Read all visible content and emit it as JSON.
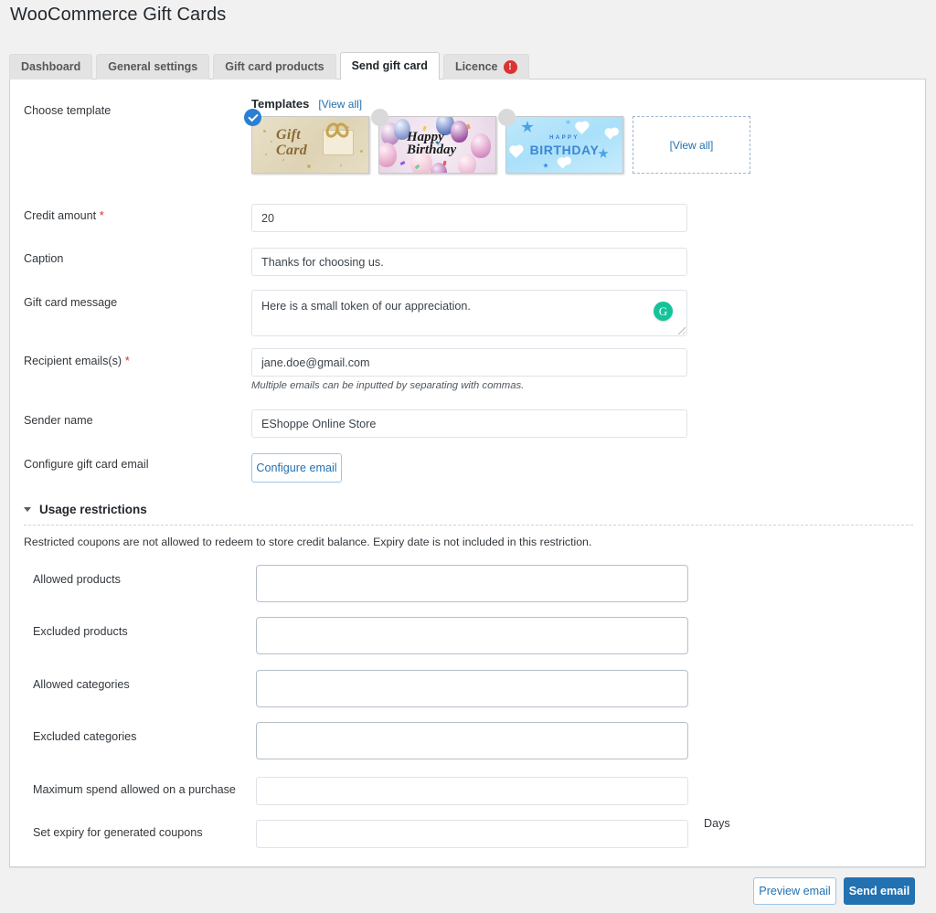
{
  "header": {
    "title": "WooCommerce Gift Cards"
  },
  "tabs": [
    {
      "label": "Dashboard",
      "active": false
    },
    {
      "label": "General settings",
      "active": false
    },
    {
      "label": "Gift card products",
      "active": false
    },
    {
      "label": "Send gift card",
      "active": true
    },
    {
      "label": "Licence",
      "active": false,
      "badge": "!"
    }
  ],
  "templates": {
    "row_label": "Choose template",
    "heading": "Templates",
    "view_all_link": "[View all]",
    "view_all_box": "[View all]",
    "items": [
      {
        "name": "gift-card-beige",
        "title_line1": "Gift",
        "title_line2": "Card",
        "selected": true
      },
      {
        "name": "happy-birthday-balloons",
        "title": "Happy Birthday",
        "selected": false
      },
      {
        "name": "happy-birthday-blue",
        "title_small": "HAPPY",
        "title_large": "BIRTHDAY",
        "selected": false
      },
      {
        "name": "view-all-placeholder",
        "selected": false
      }
    ]
  },
  "form": {
    "credit_amount": {
      "label": "Credit amount",
      "required": true,
      "value": "20"
    },
    "caption": {
      "label": "Caption",
      "required": false,
      "value": "Thanks for choosing us."
    },
    "gift_card_message": {
      "label": "Gift card message",
      "required": false,
      "value": "Here is a small token of our appreciation.",
      "assistant_icon": "grammarly-icon",
      "assistant_letter": "G"
    },
    "recipient_emails": {
      "label": "Recipient emails(s)",
      "required": true,
      "value": "jane.doe@gmail.com",
      "hint": "Multiple emails can be inputted by separating with commas."
    },
    "sender_name": {
      "label": "Sender name",
      "required": false,
      "value": "EShoppe Online Store"
    },
    "configure_email": {
      "label": "Configure gift card email",
      "button": "Configure email"
    }
  },
  "usage_restrictions": {
    "title": "Usage restrictions",
    "expanded": true,
    "note": "Restricted coupons are not allowed to redeem to store credit balance. Expiry date is not included in this restriction.",
    "fields": [
      {
        "label": "Allowed products",
        "value": "",
        "type": "multiselect"
      },
      {
        "label": "Excluded products",
        "value": "",
        "type": "multiselect"
      },
      {
        "label": "Allowed categories",
        "value": "",
        "type": "multiselect"
      },
      {
        "label": "Excluded categories",
        "value": "",
        "type": "multiselect"
      },
      {
        "label": "Maximum spend allowed on a purchase",
        "value": "",
        "type": "text"
      },
      {
        "label": "Set expiry for generated coupons",
        "value": "",
        "type": "text",
        "suffix": "Days"
      }
    ]
  },
  "footer": {
    "preview_button": "Preview email",
    "send_button": "Send email"
  },
  "colors": {
    "accent": "#2271b1",
    "danger": "#dc3232",
    "selected_check": "#2a7fd4",
    "grammarly_green": "#15c39a",
    "page_bg": "#f1f1f1"
  }
}
